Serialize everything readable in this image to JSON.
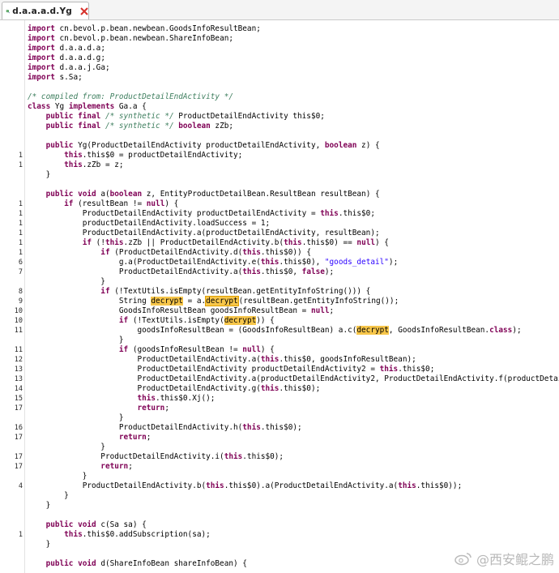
{
  "tab": {
    "title": "d.a.a.a.d.Yg",
    "icon": "java-class-search-icon",
    "close_icon": "close-icon"
  },
  "editor": {
    "lines": [
      {
        "n": "",
        "t": [
          [
            "import ",
            "kw"
          ],
          [
            "cn.bevol.p.bean.newbean.GoodsInfoResultBean;",
            ""
          ]
        ]
      },
      {
        "n": "",
        "t": [
          [
            "import ",
            "kw"
          ],
          [
            "cn.bevol.p.bean.newbean.ShareInfoBean;",
            ""
          ]
        ]
      },
      {
        "n": "",
        "t": [
          [
            "import ",
            "kw"
          ],
          [
            "d.a.a.d.a;",
            ""
          ]
        ]
      },
      {
        "n": "",
        "t": [
          [
            "import ",
            "kw"
          ],
          [
            "d.a.a.d.g;",
            ""
          ]
        ]
      },
      {
        "n": "",
        "t": [
          [
            "import ",
            "kw"
          ],
          [
            "d.a.a.j.Ga;",
            ""
          ]
        ]
      },
      {
        "n": "",
        "t": [
          [
            "import ",
            "kw"
          ],
          [
            "s.Sa;",
            ""
          ]
        ]
      },
      {
        "n": "",
        "t": []
      },
      {
        "n": "",
        "t": [
          [
            "/* compiled from: ProductDetailEndActivity */",
            "cm"
          ]
        ]
      },
      {
        "n": "",
        "t": [
          [
            "class ",
            "kw"
          ],
          [
            "Yg ",
            ""
          ],
          [
            "implements ",
            "kw"
          ],
          [
            "Ga.a {",
            ""
          ]
        ]
      },
      {
        "n": "",
        "t": [
          [
            "    public final ",
            "kw"
          ],
          [
            "/* synthetic */ ",
            "cm"
          ],
          [
            "ProductDetailEndActivity this$0;",
            ""
          ]
        ]
      },
      {
        "n": "",
        "t": [
          [
            "    public final ",
            "kw"
          ],
          [
            "/* synthetic */ ",
            "cm"
          ],
          [
            "boolean ",
            "kw"
          ],
          [
            "zZb;",
            ""
          ]
        ]
      },
      {
        "n": "",
        "t": []
      },
      {
        "n": "",
        "t": [
          [
            "    public ",
            "kw"
          ],
          [
            "Yg(ProductDetailEndActivity productDetailEndActivity, ",
            ""
          ],
          [
            "boolean ",
            "kw"
          ],
          [
            "z) {",
            ""
          ]
        ]
      },
      {
        "n": "1",
        "t": [
          [
            "        this",
            "kw"
          ],
          [
            ".this$0 = productDetailEndActivity;",
            ""
          ]
        ]
      },
      {
        "n": "1",
        "t": [
          [
            "        this",
            "kw"
          ],
          [
            ".zZb = z;",
            ""
          ]
        ]
      },
      {
        "n": "",
        "t": [
          [
            "    }",
            ""
          ]
        ]
      },
      {
        "n": "",
        "t": []
      },
      {
        "n": "",
        "t": [
          [
            "    public void ",
            "kw"
          ],
          [
            "a(",
            ""
          ],
          [
            "boolean ",
            "kw"
          ],
          [
            "z, EntityProductDetailBean.ResultBean resultBean) {",
            ""
          ]
        ]
      },
      {
        "n": "1",
        "t": [
          [
            "        if ",
            "kw"
          ],
          [
            "(resultBean != ",
            ""
          ],
          [
            "null",
            "kw"
          ],
          [
            ") {",
            ""
          ]
        ]
      },
      {
        "n": "1",
        "t": [
          [
            "            ProductDetailEndActivity productDetailEndActivity = ",
            ""
          ],
          [
            "this",
            "kw"
          ],
          [
            ".this$0;",
            ""
          ]
        ]
      },
      {
        "n": "1",
        "t": [
          [
            "            productDetailEndActivity.loadSuccess = 1;",
            ""
          ]
        ]
      },
      {
        "n": "1",
        "t": [
          [
            "            ProductDetailEndActivity.a(productDetailEndActivity, resultBean);",
            ""
          ]
        ]
      },
      {
        "n": "1",
        "t": [
          [
            "            if ",
            "kw"
          ],
          [
            "(!",
            ""
          ],
          [
            "this",
            "kw"
          ],
          [
            ".zZb || ProductDetailEndActivity.b(",
            ""
          ],
          [
            "this",
            "kw"
          ],
          [
            ".this$0) == ",
            ""
          ],
          [
            "null",
            "kw"
          ],
          [
            ") {",
            ""
          ]
        ]
      },
      {
        "n": "1",
        "t": [
          [
            "                if ",
            "kw"
          ],
          [
            "(ProductDetailEndActivity.d(",
            ""
          ],
          [
            "this",
            "kw"
          ],
          [
            ".this$0)) {",
            ""
          ]
        ]
      },
      {
        "n": "6",
        "t": [
          [
            "                    g.a(ProductDetailEndActivity.e(",
            ""
          ],
          [
            "this",
            "kw"
          ],
          [
            ".this$0), ",
            ""
          ],
          [
            "\"goods_detail\"",
            "st"
          ],
          [
            ");",
            ""
          ]
        ]
      },
      {
        "n": "7",
        "t": [
          [
            "                    ProductDetailEndActivity.a(",
            ""
          ],
          [
            "this",
            "kw"
          ],
          [
            ".this$0, ",
            ""
          ],
          [
            "false",
            "kw"
          ],
          [
            ");",
            ""
          ]
        ]
      },
      {
        "n": "",
        "t": [
          [
            "                }",
            ""
          ]
        ]
      },
      {
        "n": "8",
        "t": [
          [
            "                if ",
            "kw"
          ],
          [
            "(!TextUtils.isEmpty(resultBean.getEntityInfoString())) {",
            ""
          ]
        ]
      },
      {
        "n": "9",
        "t": [
          [
            "                    String ",
            ""
          ],
          [
            "decrypt",
            "hl"
          ],
          [
            " = a.",
            ""
          ],
          [
            "decrypt",
            "hlbox"
          ],
          [
            "(resultBean.getEntityInfoString());",
            ""
          ]
        ]
      },
      {
        "n": "10",
        "t": [
          [
            "                    GoodsInfoResultBean goodsInfoResultBean = ",
            ""
          ],
          [
            "null",
            "kw"
          ],
          [
            ";",
            ""
          ]
        ]
      },
      {
        "n": "10",
        "t": [
          [
            "                    if ",
            "kw"
          ],
          [
            "(!TextUtils.isEmpty(",
            ""
          ],
          [
            "decrypt",
            "hl"
          ],
          [
            ")) {",
            ""
          ]
        ]
      },
      {
        "n": "11",
        "t": [
          [
            "                        goodsInfoResultBean = (GoodsInfoResultBean) a.c(",
            ""
          ],
          [
            "decrypt",
            "hl"
          ],
          [
            ", GoodsInfoResultBean.",
            ""
          ],
          [
            "class",
            "kw"
          ],
          [
            ");",
            ""
          ]
        ]
      },
      {
        "n": "",
        "t": [
          [
            "                    }",
            ""
          ]
        ]
      },
      {
        "n": "11",
        "t": [
          [
            "                    if ",
            "kw"
          ],
          [
            "(goodsInfoResultBean != ",
            ""
          ],
          [
            "null",
            "kw"
          ],
          [
            ") {",
            ""
          ]
        ]
      },
      {
        "n": "12",
        "t": [
          [
            "                        ProductDetailEndActivity.a(",
            ""
          ],
          [
            "this",
            "kw"
          ],
          [
            ".this$0, goodsInfoResultBean);",
            ""
          ]
        ]
      },
      {
        "n": "13",
        "t": [
          [
            "                        ProductDetailEndActivity productDetailEndActivity2 = ",
            ""
          ],
          [
            "this",
            "kw"
          ],
          [
            ".this$0;",
            ""
          ]
        ]
      },
      {
        "n": "13",
        "t": [
          [
            "                        ProductDetailEndActivity.a(productDetailEndActivity2, ProductDetailEndActivity.f(productDetailEndActi",
            ""
          ]
        ]
      },
      {
        "n": "14",
        "t": [
          [
            "                        ProductDetailEndActivity.g(",
            ""
          ],
          [
            "this",
            "kw"
          ],
          [
            ".this$0);",
            ""
          ]
        ]
      },
      {
        "n": "15",
        "t": [
          [
            "                        this",
            "kw"
          ],
          [
            ".this$0.Xj();",
            ""
          ]
        ]
      },
      {
        "n": "17",
        "t": [
          [
            "                        return",
            "kw"
          ],
          [
            ";",
            ""
          ]
        ]
      },
      {
        "n": "",
        "t": [
          [
            "                    }",
            ""
          ]
        ]
      },
      {
        "n": "16",
        "t": [
          [
            "                    ProductDetailEndActivity.h(",
            ""
          ],
          [
            "this",
            "kw"
          ],
          [
            ".this$0);",
            ""
          ]
        ]
      },
      {
        "n": "17",
        "t": [
          [
            "                    return",
            "kw"
          ],
          [
            ";",
            ""
          ]
        ]
      },
      {
        "n": "",
        "t": [
          [
            "                }",
            ""
          ]
        ]
      },
      {
        "n": "17",
        "t": [
          [
            "                ProductDetailEndActivity.i(",
            ""
          ],
          [
            "this",
            "kw"
          ],
          [
            ".this$0);",
            ""
          ]
        ]
      },
      {
        "n": "17",
        "t": [
          [
            "                return",
            "kw"
          ],
          [
            ";",
            ""
          ]
        ]
      },
      {
        "n": "",
        "t": [
          [
            "            }",
            ""
          ]
        ]
      },
      {
        "n": "4",
        "t": [
          [
            "            ProductDetailEndActivity.b(",
            ""
          ],
          [
            "this",
            "kw"
          ],
          [
            ".this$0).a(ProductDetailEndActivity.a(",
            ""
          ],
          [
            "this",
            "kw"
          ],
          [
            ".this$0));",
            ""
          ]
        ]
      },
      {
        "n": "",
        "t": [
          [
            "        }",
            ""
          ]
        ]
      },
      {
        "n": "",
        "t": [
          [
            "    }",
            ""
          ]
        ]
      },
      {
        "n": "",
        "t": []
      },
      {
        "n": "",
        "t": [
          [
            "    public void ",
            "kw"
          ],
          [
            "c(Sa sa) {",
            ""
          ]
        ]
      },
      {
        "n": "1",
        "t": [
          [
            "        this",
            "kw"
          ],
          [
            ".this$0.addSubscription(sa);",
            ""
          ]
        ]
      },
      {
        "n": "",
        "t": [
          [
            "    }",
            ""
          ]
        ]
      },
      {
        "n": "",
        "t": []
      },
      {
        "n": "",
        "t": [
          [
            "    public void ",
            "kw"
          ],
          [
            "d(ShareInfoBean shareInfoBean) {",
            ""
          ]
        ]
      }
    ]
  },
  "watermark": {
    "text": "@西安鲲之鹏",
    "icon": "weibo-logo-icon"
  }
}
